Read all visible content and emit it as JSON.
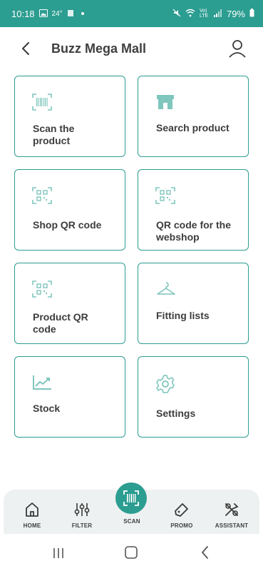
{
  "status_bar": {
    "time": "10:18",
    "temp": "24°",
    "battery": "79%",
    "network": "Vo) LTE"
  },
  "header": {
    "title": "Buzz Mega Mall"
  },
  "tiles": [
    {
      "label_line1": "Scan the",
      "label_line2": "product",
      "icon": "barcode-icon"
    },
    {
      "label_line1": "Search product",
      "label_line2": "",
      "icon": "store-icon"
    },
    {
      "label_line1": "Shop QR code",
      "label_line2": "",
      "icon": "qr-code-icon"
    },
    {
      "label_line1": "QR code for the",
      "label_line2": "webshop",
      "icon": "qr-code-icon"
    },
    {
      "label_line1": "Product QR",
      "label_line2": "code",
      "icon": "qr-code-icon"
    },
    {
      "label_line1": "Fitting lists",
      "label_line2": "",
      "icon": "hanger-icon"
    },
    {
      "label_line1": "Stock",
      "label_line2": "",
      "icon": "trend-chart-icon"
    },
    {
      "label_line1": "Settings",
      "label_line2": "",
      "icon": "gear-icon"
    }
  ],
  "bottom_nav": {
    "home": "HOME",
    "filter": "FILTER",
    "scan": "SCAN",
    "promo": "PROMO",
    "assistant": "ASSISTANT"
  },
  "colors": {
    "accent": "#2c9d91",
    "icon_light": "#7fc6bd",
    "text": "#3d3d3d"
  }
}
